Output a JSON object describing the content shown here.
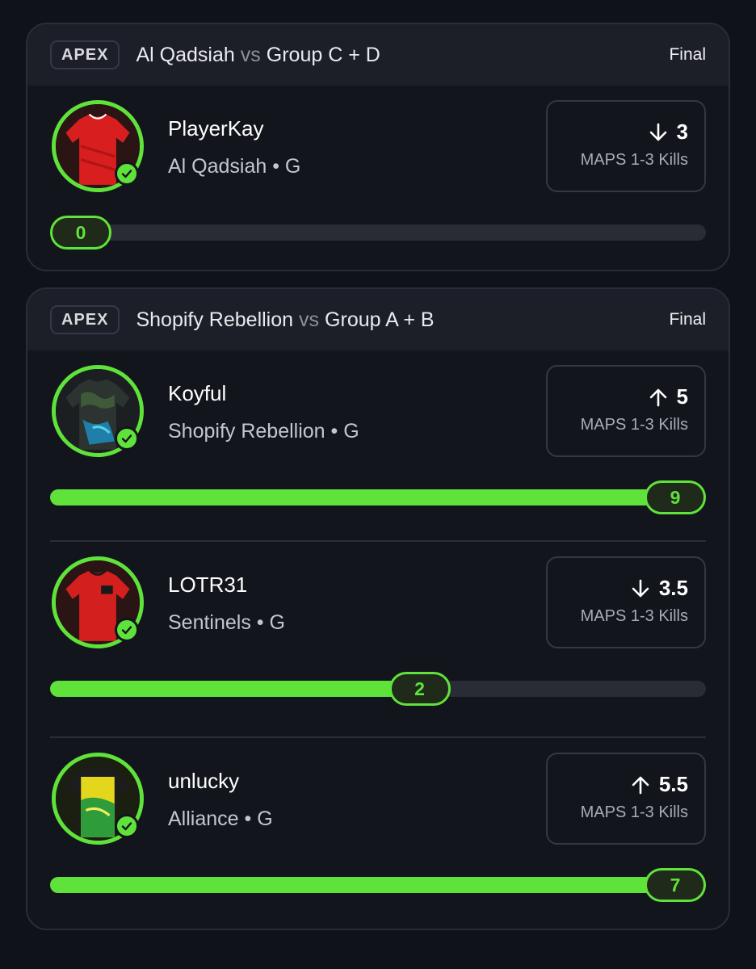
{
  "colors": {
    "accent": "#5fe23a",
    "background": "#10121a",
    "card": "#13151d"
  },
  "cards": [
    {
      "league": "APEX",
      "team_a": "Al Qadsiah",
      "vs": "vs",
      "team_b": "Group C + D",
      "status": "Final",
      "players": [
        {
          "name": "PlayerKay",
          "team": "Al Qadsiah • G",
          "direction": "down",
          "direction_icon": "arrow-down-icon",
          "line": "3",
          "stat": "MAPS 1-3 Kills",
          "actual": "0",
          "progress": 0,
          "jersey": "red"
        }
      ]
    },
    {
      "league": "APEX",
      "team_a": "Shopify Rebellion",
      "vs": "vs",
      "team_b": "Group A + B",
      "status": "Final",
      "players": [
        {
          "name": "Koyful",
          "team": "Shopify Rebellion • G",
          "direction": "up",
          "direction_icon": "arrow-up-icon",
          "line": "5",
          "stat": "MAPS 1-3 Kills",
          "actual": "9",
          "progress": 1.0,
          "jersey": "camo"
        },
        {
          "name": "LOTR31",
          "team": "Sentinels • G",
          "direction": "down",
          "direction_icon": "arrow-down-icon",
          "line": "3.5",
          "stat": "MAPS 1-3 Kills",
          "actual": "2",
          "progress": 0.57,
          "jersey": "red"
        },
        {
          "name": "unlucky",
          "team": "Alliance • G",
          "direction": "up",
          "direction_icon": "arrow-up-icon",
          "line": "5.5",
          "stat": "MAPS 1-3 Kills",
          "actual": "7",
          "progress": 1.0,
          "jersey": "yellow"
        }
      ]
    }
  ]
}
